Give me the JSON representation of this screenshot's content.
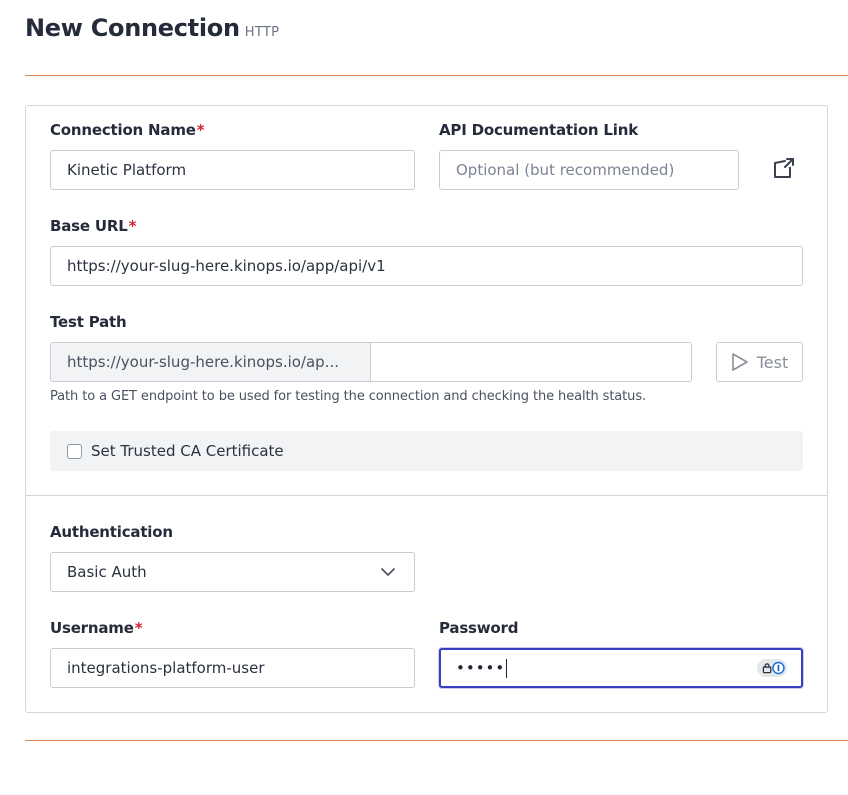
{
  "header": {
    "title": "New Connection",
    "subtitle": "HTTP"
  },
  "form": {
    "connection_name": {
      "label": "Connection Name",
      "required_mark": "*",
      "value": "Kinetic Platform"
    },
    "api_doc_link": {
      "label": "API Documentation Link",
      "placeholder": "Optional (but recommended)",
      "icon": "external-link-icon"
    },
    "base_url": {
      "label": "Base URL",
      "required_mark": "*",
      "value": "https://your-slug-here.kinops.io/app/api/v1"
    },
    "test_path": {
      "label": "Test Path",
      "prefix": "https://your-slug-here.kinops.io/ap...",
      "value": "",
      "button_label": "Test",
      "button_icon": "play-icon",
      "help_text": "Path to a GET endpoint to be used for testing the connection and checking the health status."
    },
    "trusted_ca": {
      "label": "Set Trusted CA Certificate",
      "checked": false
    },
    "authentication": {
      "label": "Authentication",
      "selected": "Basic Auth",
      "icon": "chevron-down-icon"
    },
    "username": {
      "label": "Username",
      "required_mark": "*",
      "value": "integrations-platform-user"
    },
    "password": {
      "label": "Password",
      "masked_value": "•••••",
      "password_manager_icon": "password-manager-icon"
    }
  },
  "colors": {
    "accent_rule": "#d98b5c",
    "required": "#d11f2f",
    "focus_border": "#3a3fbf"
  }
}
